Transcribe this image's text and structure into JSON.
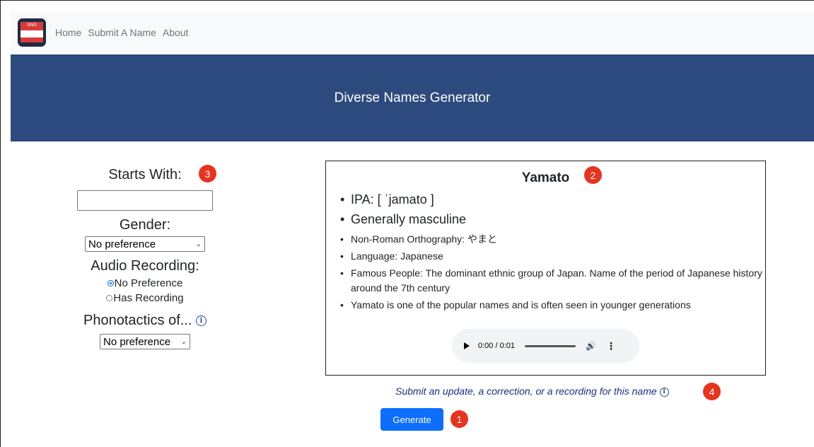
{
  "nav": {
    "logo_text": "DNG",
    "links": [
      "Home",
      "Submit A Name",
      "About"
    ]
  },
  "banner": {
    "title": "Diverse Names Generator"
  },
  "filters": {
    "starts_with_label": "Starts With:",
    "starts_with_value": "",
    "gender_label": "Gender:",
    "gender_selected": "No preference",
    "audio_label": "Audio Recording:",
    "audio_options": [
      "No Preference",
      "Has Recording"
    ],
    "audio_selected": "No Preference",
    "phonotactics_label": "Phonotactics of...",
    "phonotactics_selected": "No preference"
  },
  "name_card": {
    "name": "Yamato",
    "ipa": "IPA: [ ˈjamato ]",
    "gender_note": "Generally masculine",
    "details": [
      "Non-Roman Orthography: やまと",
      "Language: Japanese",
      "Famous People: The dominant ethnic group of Japan. Name of the period of Japanese history around the 7th century",
      "Yamato is one of the popular names and is often seen in younger generations"
    ],
    "audio_time": "0:00 / 0:01"
  },
  "submit_update_text": "Submit an update, a correction, or a recording for this name",
  "generate_label": "Generate",
  "badges": [
    "1",
    "2",
    "3",
    "4"
  ],
  "colors": {
    "banner": "#2d4a7e",
    "badge": "#e8331e",
    "primary_button": "#0d6efd",
    "link_italic": "#1b2d8a"
  }
}
